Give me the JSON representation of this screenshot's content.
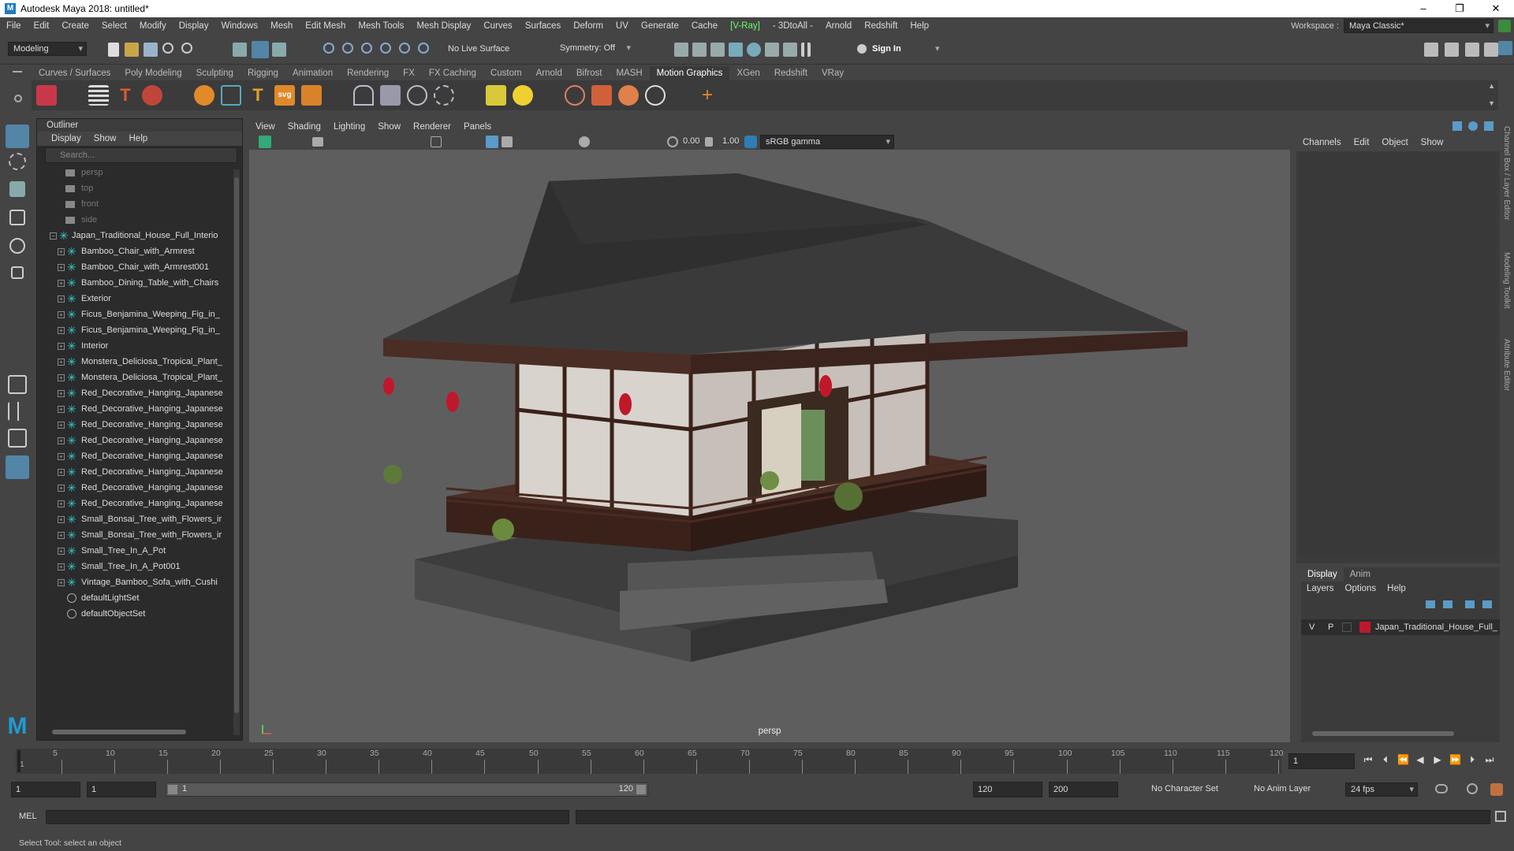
{
  "window": {
    "title": "Autodesk Maya 2018: untitled*",
    "minimize": "–",
    "maximize": "❐",
    "close": "✕"
  },
  "menus": [
    "File",
    "Edit",
    "Create",
    "Select",
    "Modify",
    "Display",
    "Windows",
    "Mesh",
    "Edit Mesh",
    "Mesh Tools",
    "Mesh Display",
    "Curves",
    "Surfaces",
    "Deform",
    "UV",
    "Generate",
    "Cache",
    "[V-Ray]",
    "- 3DtoAll -",
    "Arnold",
    "Redshift",
    "Help"
  ],
  "workspace": {
    "label": "Workspace :",
    "value": "Maya Classic*"
  },
  "status_line": {
    "mode": "Modeling",
    "live_surface": "No Live Surface",
    "symmetry": "Symmetry: Off",
    "sign_in": "Sign In"
  },
  "shelf_tabs": [
    "Curves / Surfaces",
    "Poly Modeling",
    "Sculpting",
    "Rigging",
    "Animation",
    "Rendering",
    "FX",
    "FX Caching",
    "Custom",
    "Arnold",
    "Bifrost",
    "MASH",
    "Motion Graphics",
    "XGen",
    "Redshift",
    "VRay"
  ],
  "shelf_active_tab": "Motion Graphics",
  "outliner": {
    "title": "Outliner",
    "menu": [
      "Display",
      "Show",
      "Help"
    ],
    "search_placeholder": "Search...",
    "cameras": [
      "persp",
      "top",
      "front",
      "side"
    ],
    "root": "Japan_Traditional_House_Full_Interio",
    "children": [
      "Bamboo_Chair_with_Armrest",
      "Bamboo_Chair_with_Armrest001",
      "Bamboo_Dining_Table_with_Chairs",
      "Exterior",
      "Ficus_Benjamina_Weeping_Fig_in_",
      "Ficus_Benjamina_Weeping_Fig_in_",
      "Interior",
      "Monstera_Deliciosa_Tropical_Plant_",
      "Monstera_Deliciosa_Tropical_Plant_",
      "Red_Decorative_Hanging_Japanese",
      "Red_Decorative_Hanging_Japanese",
      "Red_Decorative_Hanging_Japanese",
      "Red_Decorative_Hanging_Japanese",
      "Red_Decorative_Hanging_Japanese",
      "Red_Decorative_Hanging_Japanese",
      "Red_Decorative_Hanging_Japanese",
      "Red_Decorative_Hanging_Japanese",
      "Small_Bonsai_Tree_with_Flowers_ir",
      "Small_Bonsai_Tree_with_Flowers_ir",
      "Small_Tree_In_A_Pot",
      "Small_Tree_In_A_Pot001",
      "Vintage_Bamboo_Sofa_with_Cushi"
    ],
    "sets": [
      "defaultLightSet",
      "defaultObjectSet"
    ]
  },
  "viewport": {
    "menu": [
      "View",
      "Shading",
      "Lighting",
      "Show",
      "Renderer",
      "Panels"
    ],
    "value_a": "0.00",
    "value_b": "1.00",
    "color_space": "sRGB gamma",
    "camera_label": "persp"
  },
  "channel_box": {
    "menu": [
      "Channels",
      "Edit",
      "Object",
      "Show"
    ]
  },
  "side_tabs": [
    "Channel Box / Layer Editor",
    "Modeling Toolkit",
    "Attribute Editor"
  ],
  "layer_editor": {
    "tabs": [
      "Display",
      "Anim"
    ],
    "menu": [
      "Layers",
      "Options",
      "Help"
    ],
    "layer": {
      "v": "V",
      "p": "P",
      "name": "Japan_Traditional_House_Full_",
      "color": "#c0182b"
    }
  },
  "time_slider": {
    "ticks": [
      "5",
      "10",
      "15",
      "20",
      "25",
      "30",
      "35",
      "40",
      "45",
      "50",
      "55",
      "60",
      "65",
      "70",
      "75",
      "80",
      "85",
      "90",
      "95",
      "100",
      "105",
      "110",
      "115",
      "120"
    ],
    "first_tick": "1",
    "current_frame": "1"
  },
  "range_slider": {
    "start": "1",
    "playback_start": "1",
    "range_handle_start": "1",
    "range_handle_end": "120",
    "playback_end": "120",
    "end": "200",
    "character_set": "No Character Set",
    "anim_layer": "No Anim Layer",
    "fps": "24 fps"
  },
  "command_line": {
    "label": "MEL"
  },
  "help_line": {
    "text": "Select Tool: select an object"
  },
  "colors": {
    "accent": "#1f7bbf",
    "selected_tool": "#5285a6",
    "lantern_red": "#c0182b",
    "vray_green": "#66ff66"
  }
}
